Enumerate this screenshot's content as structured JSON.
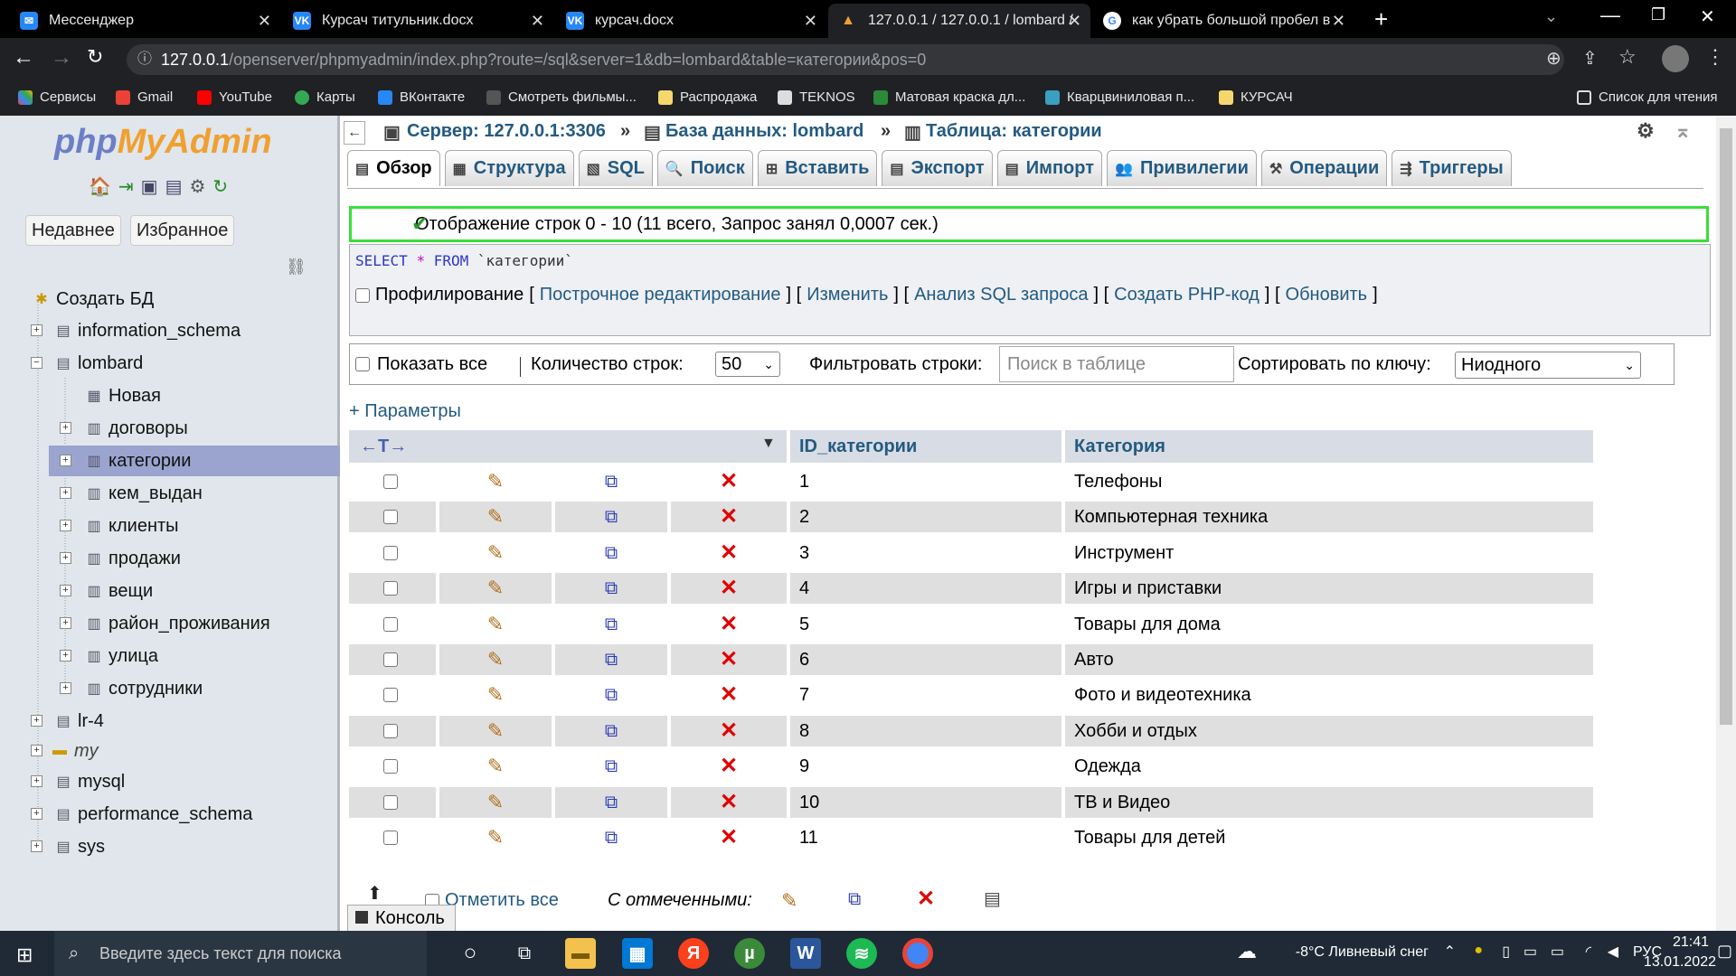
{
  "browser": {
    "tabs": [
      {
        "title": "Мессенджер",
        "color": "#2787f5",
        "glyph": "💬"
      },
      {
        "title": "Курсач титульник.docx",
        "color": "#2787f5",
        "glyph": "VK"
      },
      {
        "title": "курсач.docx",
        "color": "#2787f5",
        "glyph": "VK"
      },
      {
        "title": "127.0.0.1 / 127.0.0.1 / lombard /",
        "color": "#f0a030",
        "glyph": "▲"
      },
      {
        "title": "как убрать большой пробел в",
        "color": "#ffffff",
        "glyph": "G"
      }
    ],
    "url_host": "127.0.0.1",
    "url_path": "/openserver/phpmyadmin/index.php?route=/sql&server=1&db=lombard&table=категории&pos=0",
    "bookmarks": [
      "Сервисы",
      "Gmail",
      "YouTube",
      "Карты",
      "ВКонтакте",
      "Смотреть фильмы...",
      "Распродажа",
      "TEKNOS",
      "Матовая краска дл...",
      "Кварцвиниловая п...",
      "КУРСАЧ"
    ],
    "reading_list": "Список для чтения"
  },
  "sidebar": {
    "logo_a": "php",
    "logo_b": "MyAdmin",
    "recent": "Недавнее",
    "favorites": "Избранное",
    "create_db": "Создать БД",
    "databases": [
      "information_schema",
      "lombard",
      "lr-4",
      "my",
      "mysql",
      "performance_schema",
      "sys"
    ],
    "lombard_new": "Новая",
    "tables": [
      "договоры",
      "категории",
      "кем_выдан",
      "клиенты",
      "продажи",
      "вещи",
      "район_проживания",
      "улица",
      "сотрудники"
    ]
  },
  "breadcrumb": {
    "server": "Сервер: 127.0.0.1:3306",
    "database": "База данных: lombard",
    "table": "Таблица: категории"
  },
  "tabs": [
    "Обзор",
    "Структура",
    "SQL",
    "Поиск",
    "Вставить",
    "Экспорт",
    "Импорт",
    "Привилегии",
    "Операции",
    "Триггеры"
  ],
  "success_message": "Отображение строк 0 - 10 (11 всего, Запрос занял 0,0007 сек.)",
  "sql": {
    "select": "SELECT",
    "star": "*",
    "from": "FROM",
    "table": "`категории`"
  },
  "sql_links": {
    "profiling": "Профилирование",
    "inline_edit": "Построчное редактирование",
    "edit": "Изменить",
    "explain": "Анализ SQL запроса",
    "php_code": "Создать PHP-код",
    "refresh": "Обновить"
  },
  "filter": {
    "show_all": "Показать все",
    "row_count_label": "Количество строк:",
    "row_count": "50",
    "filter_label": "Фильтровать строки:",
    "filter_placeholder": "Поиск в таблице",
    "sort_label": "Сортировать по ключу:",
    "sort_value": "Ниодного"
  },
  "params": "+ Параметры",
  "columns": [
    "ID_категории",
    "Категория"
  ],
  "rows": [
    [
      "1",
      "Телефоны"
    ],
    [
      "2",
      "Компьютерная техника"
    ],
    [
      "3",
      "Инструмент"
    ],
    [
      "4",
      "Игры и приставки"
    ],
    [
      "5",
      "Товары для дома"
    ],
    [
      "6",
      "Авто"
    ],
    [
      "7",
      "Фото и видеотехника"
    ],
    [
      "8",
      "Хобби и отдых"
    ],
    [
      "9",
      "Одежда"
    ],
    [
      "10",
      "ТВ и Видео"
    ],
    [
      "11",
      "Товары для детей"
    ]
  ],
  "bottom": {
    "check_all": "Отметить все",
    "with_selected": "С отмеченными:"
  },
  "console": "Консоль",
  "taskbar": {
    "search_placeholder": "Введите здесь текст для поиска",
    "weather": "-8°C  Ливневый снег",
    "lang": "РУС",
    "time": "21:41",
    "date": "13.01.2022"
  }
}
